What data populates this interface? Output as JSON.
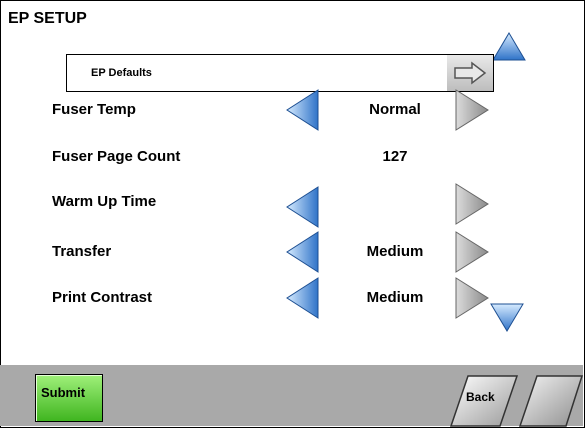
{
  "header": {
    "title": "EP SETUP"
  },
  "defaults": {
    "label": "EP Defaults",
    "icon": "arrow-right-icon"
  },
  "settings": [
    {
      "label": "Fuser Temp",
      "value": "Normal",
      "has_arrows": true
    },
    {
      "label": "Fuser Page Count",
      "value": "127",
      "has_arrows": false
    },
    {
      "label": "Warm Up Time",
      "value": "",
      "has_arrows": true
    },
    {
      "label": "Transfer",
      "value": "Medium",
      "has_arrows": true
    },
    {
      "label": "Print Contrast",
      "value": "Medium",
      "has_arrows": true
    }
  ],
  "footer": {
    "submit_label": "Submit",
    "back_label": "Back"
  },
  "colors": {
    "arrow_blue": "#3f7fd0",
    "submit_green": "#40b520",
    "footer_gray": "#a9a9a9"
  }
}
